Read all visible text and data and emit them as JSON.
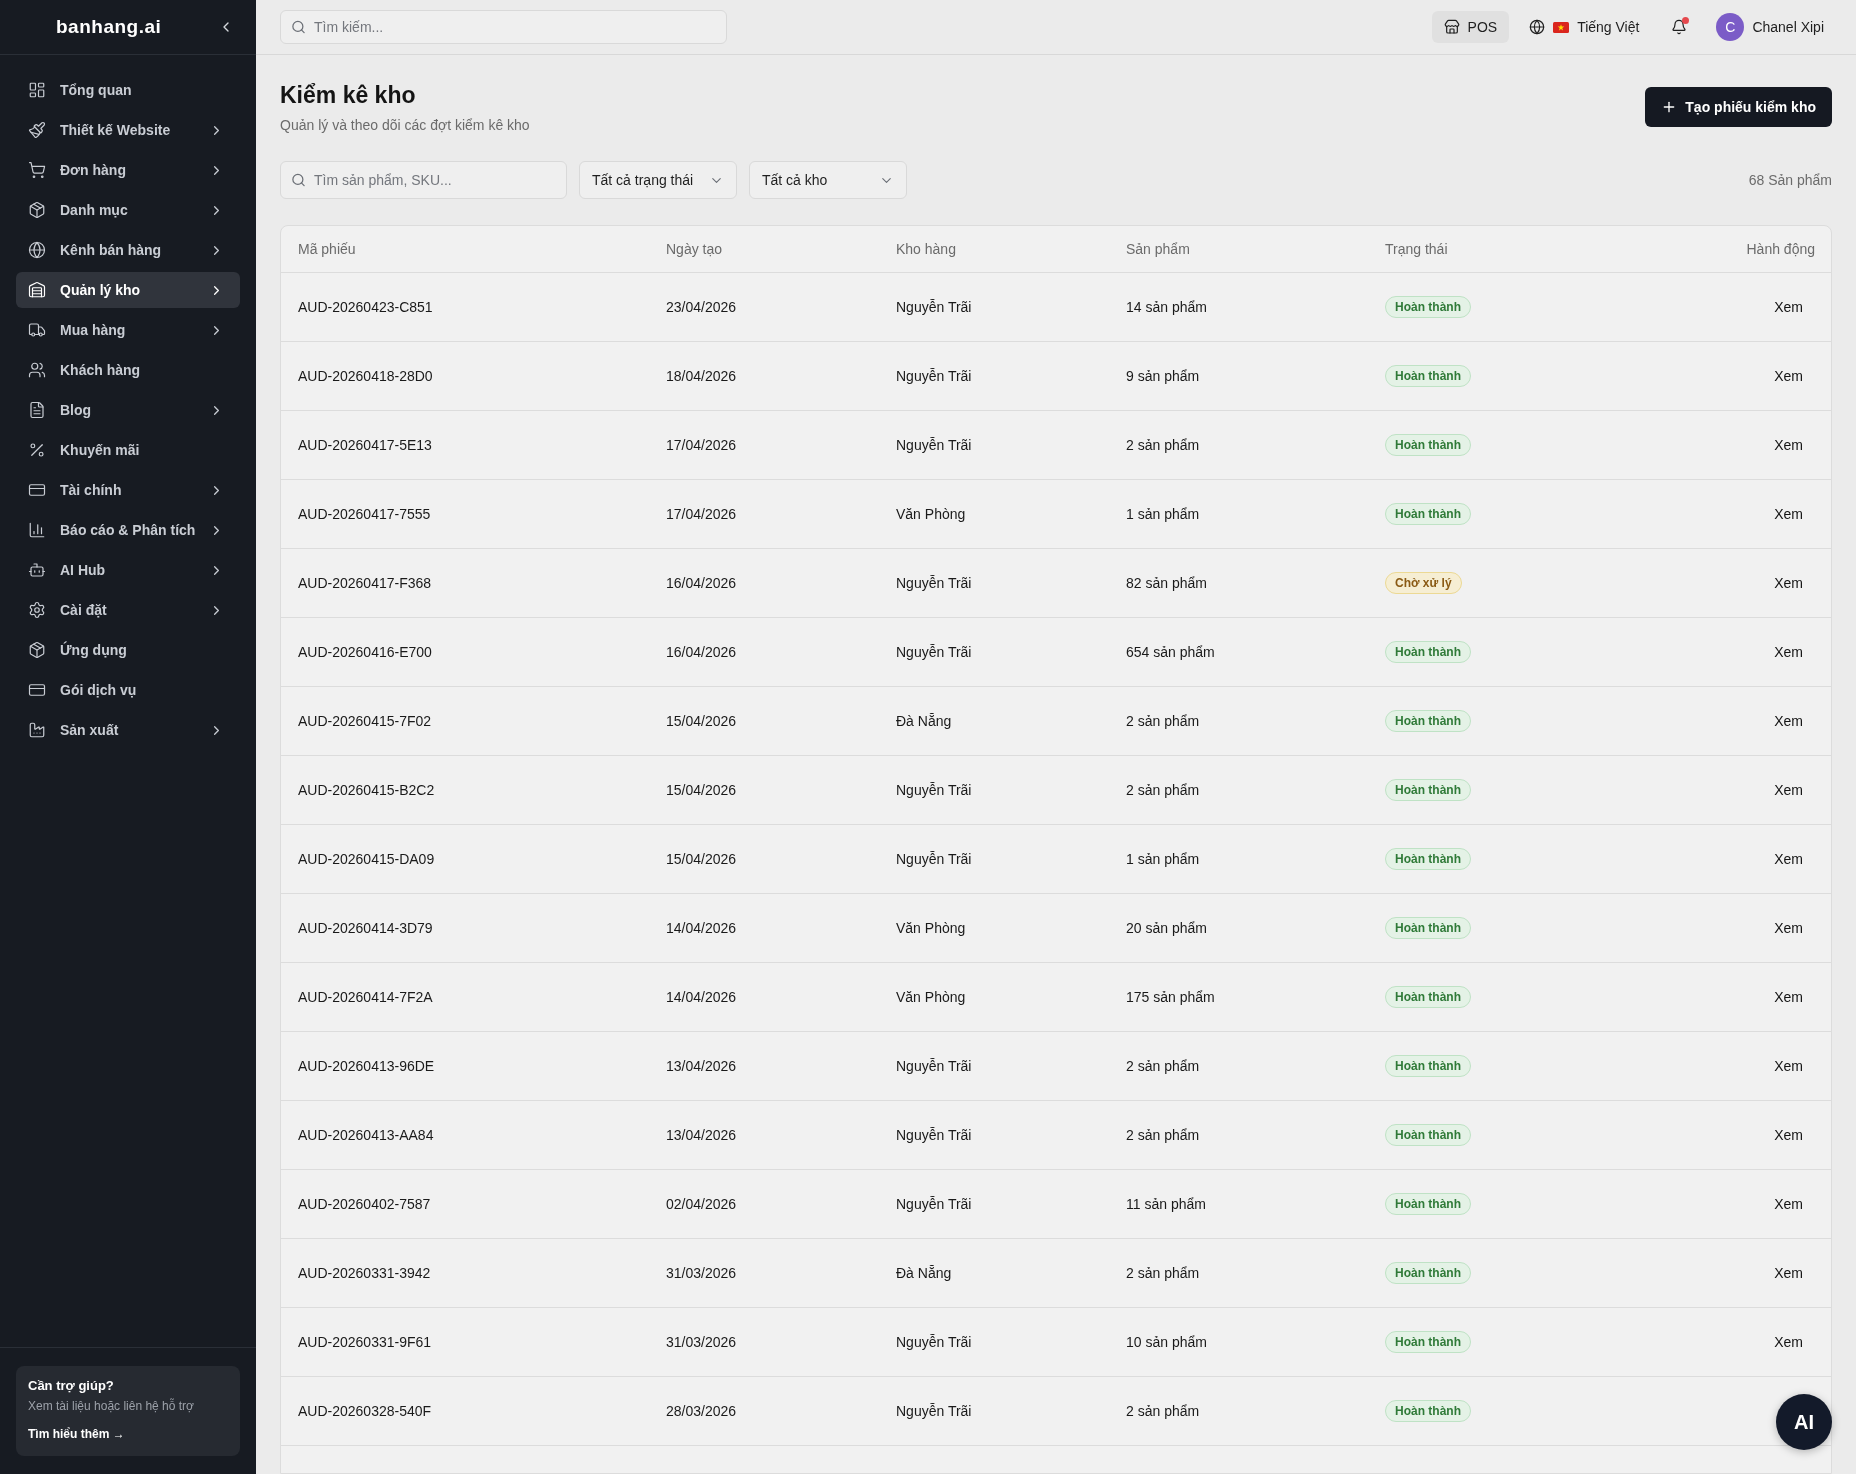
{
  "sidebar": {
    "logo": "banhang.ai",
    "items": [
      {
        "label": "Tổng quan",
        "expandable": false,
        "selected": false
      },
      {
        "label": "Thiết kế Website",
        "expandable": true,
        "selected": false
      },
      {
        "label": "Đơn hàng",
        "expandable": true,
        "selected": false
      },
      {
        "label": "Danh mục",
        "expandable": true,
        "selected": false
      },
      {
        "label": "Kênh bán hàng",
        "expandable": true,
        "selected": false
      },
      {
        "label": "Quản lý kho",
        "expandable": true,
        "selected": true
      },
      {
        "label": "Mua hàng",
        "expandable": true,
        "selected": false
      },
      {
        "label": "Khách hàng",
        "expandable": false,
        "selected": false
      },
      {
        "label": "Blog",
        "expandable": true,
        "selected": false
      },
      {
        "label": "Khuyến mãi",
        "expandable": false,
        "selected": false
      },
      {
        "label": "Tài chính",
        "expandable": true,
        "selected": false
      },
      {
        "label": "Báo cáo & Phân tích",
        "expandable": true,
        "selected": false
      },
      {
        "label": "AI Hub",
        "expandable": true,
        "selected": false
      },
      {
        "label": "Cài đặt",
        "expandable": true,
        "selected": false
      },
      {
        "label": "Ứng dụng",
        "expandable": false,
        "selected": false
      },
      {
        "label": "Gói dịch vụ",
        "expandable": false,
        "selected": false
      },
      {
        "label": "Sản xuất",
        "expandable": true,
        "selected": false
      }
    ],
    "help": {
      "title": "Cần trợ giúp?",
      "text": "Xem tài liệu hoặc liên hệ hỗ trợ",
      "link": "Tìm hiểu thêm →"
    }
  },
  "topbar": {
    "search": {
      "placeholder": "Tìm kiếm..."
    },
    "pos_button": "POS",
    "language": "Tiếng Việt",
    "notifications": {
      "unread": true
    },
    "user": {
      "initial": "C",
      "name": "Chanel Xipi"
    }
  },
  "page": {
    "title": "Kiểm kê kho",
    "subtitle": "Quản lý và theo dõi các đợt kiểm kê kho",
    "create_button": "Tạo phiếu kiểm kho"
  },
  "filters": {
    "search": {
      "placeholder": "Tìm sản phẩm, SKU..."
    },
    "dropdowns": [
      {
        "value": "Tất cả trạng thái"
      },
      {
        "value": "Tất cả kho"
      }
    ],
    "count": "68 Sản phẩm"
  },
  "table": {
    "columns": [
      "Mã phiếu",
      "Ngày tạo",
      "Kho hàng",
      "Sản phẩm",
      "Trạng thái",
      "Hành động"
    ],
    "rows": [
      {
        "code": "AUD-20260423-C851",
        "date": "23/04/2026",
        "warehouse": "Nguyễn Trãi",
        "products": "14 sản phẩm",
        "status": {
          "label": "Hoàn thành",
          "kind": "done"
        },
        "action": "Xem"
      },
      {
        "code": "AUD-20260418-28D0",
        "date": "18/04/2026",
        "warehouse": "Nguyễn Trãi",
        "products": "9 sản phẩm",
        "status": {
          "label": "Hoàn thành",
          "kind": "done"
        },
        "action": "Xem"
      },
      {
        "code": "AUD-20260417-5E13",
        "date": "17/04/2026",
        "warehouse": "Nguyễn Trãi",
        "products": "2 sản phẩm",
        "status": {
          "label": "Hoàn thành",
          "kind": "done"
        },
        "action": "Xem"
      },
      {
        "code": "AUD-20260417-7555",
        "date": "17/04/2026",
        "warehouse": "Văn Phòng",
        "products": "1 sản phẩm",
        "status": {
          "label": "Hoàn thành",
          "kind": "done"
        },
        "action": "Xem"
      },
      {
        "code": "AUD-20260417-F368",
        "date": "16/04/2026",
        "warehouse": "Nguyễn Trãi",
        "products": "82 sản phẩm",
        "status": {
          "label": "Chờ xử lý",
          "kind": "pending"
        },
        "action": "Xem"
      },
      {
        "code": "AUD-20260416-E700",
        "date": "16/04/2026",
        "warehouse": "Nguyễn Trãi",
        "products": "654 sản phẩm",
        "status": {
          "label": "Hoàn thành",
          "kind": "done"
        },
        "action": "Xem"
      },
      {
        "code": "AUD-20260415-7F02",
        "date": "15/04/2026",
        "warehouse": "Đà Nẵng",
        "products": "2 sản phẩm",
        "status": {
          "label": "Hoàn thành",
          "kind": "done"
        },
        "action": "Xem"
      },
      {
        "code": "AUD-20260415-B2C2",
        "date": "15/04/2026",
        "warehouse": "Nguyễn Trãi",
        "products": "2 sản phẩm",
        "status": {
          "label": "Hoàn thành",
          "kind": "done"
        },
        "action": "Xem"
      },
      {
        "code": "AUD-20260415-DA09",
        "date": "15/04/2026",
        "warehouse": "Nguyễn Trãi",
        "products": "1 sản phẩm",
        "status": {
          "label": "Hoàn thành",
          "kind": "done"
        },
        "action": "Xem"
      },
      {
        "code": "AUD-20260414-3D79",
        "date": "14/04/2026",
        "warehouse": "Văn Phòng",
        "products": "20 sản phẩm",
        "status": {
          "label": "Hoàn thành",
          "kind": "done"
        },
        "action": "Xem"
      },
      {
        "code": "AUD-20260414-7F2A",
        "date": "14/04/2026",
        "warehouse": "Văn Phòng",
        "products": "175 sản phẩm",
        "status": {
          "label": "Hoàn thành",
          "kind": "done"
        },
        "action": "Xem"
      },
      {
        "code": "AUD-20260413-96DE",
        "date": "13/04/2026",
        "warehouse": "Nguyễn Trãi",
        "products": "2 sản phẩm",
        "status": {
          "label": "Hoàn thành",
          "kind": "done"
        },
        "action": "Xem"
      },
      {
        "code": "AUD-20260413-AA84",
        "date": "13/04/2026",
        "warehouse": "Nguyễn Trãi",
        "products": "2 sản phẩm",
        "status": {
          "label": "Hoàn thành",
          "kind": "done"
        },
        "action": "Xem"
      },
      {
        "code": "AUD-20260402-7587",
        "date": "02/04/2026",
        "warehouse": "Nguyễn Trãi",
        "products": "11 sản phẩm",
        "status": {
          "label": "Hoàn thành",
          "kind": "done"
        },
        "action": "Xem"
      },
      {
        "code": "AUD-20260331-3942",
        "date": "31/03/2026",
        "warehouse": "Đà Nẵng",
        "products": "2 sản phẩm",
        "status": {
          "label": "Hoàn thành",
          "kind": "done"
        },
        "action": "Xem"
      },
      {
        "code": "AUD-20260331-9F61",
        "date": "31/03/2026",
        "warehouse": "Nguyễn Trãi",
        "products": "10 sản phẩm",
        "status": {
          "label": "Hoàn thành",
          "kind": "done"
        },
        "action": "Xem"
      },
      {
        "code": "AUD-20260328-540F",
        "date": "28/03/2026",
        "warehouse": "Nguyễn Trãi",
        "products": "2 sản phẩm",
        "status": {
          "label": "Hoàn thành",
          "kind": "done"
        }
      }
    ]
  },
  "ai_button": "AI"
}
